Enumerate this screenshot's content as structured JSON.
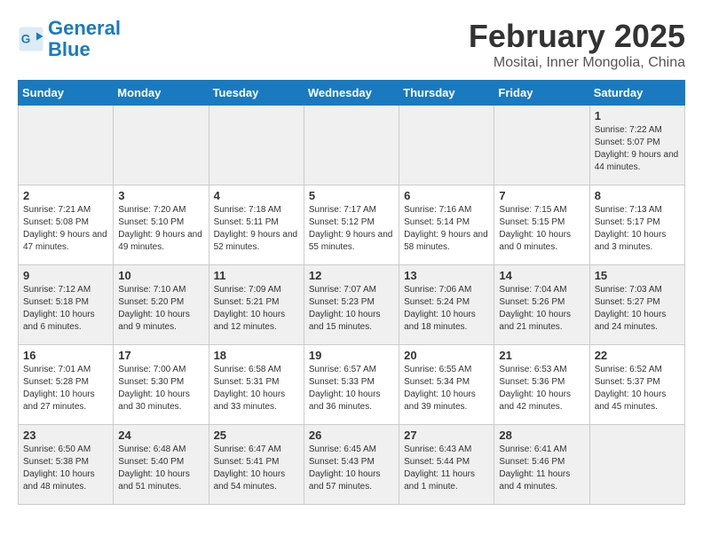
{
  "header": {
    "logo_line1": "General",
    "logo_line2": "Blue",
    "month_year": "February 2025",
    "location": "Mositai, Inner Mongolia, China"
  },
  "weekdays": [
    "Sunday",
    "Monday",
    "Tuesday",
    "Wednesday",
    "Thursday",
    "Friday",
    "Saturday"
  ],
  "weeks": [
    [
      {
        "day": "",
        "info": ""
      },
      {
        "day": "",
        "info": ""
      },
      {
        "day": "",
        "info": ""
      },
      {
        "day": "",
        "info": ""
      },
      {
        "day": "",
        "info": ""
      },
      {
        "day": "",
        "info": ""
      },
      {
        "day": "1",
        "info": "Sunrise: 7:22 AM\nSunset: 5:07 PM\nDaylight: 9 hours and 44 minutes."
      }
    ],
    [
      {
        "day": "2",
        "info": "Sunrise: 7:21 AM\nSunset: 5:08 PM\nDaylight: 9 hours and 47 minutes."
      },
      {
        "day": "3",
        "info": "Sunrise: 7:20 AM\nSunset: 5:10 PM\nDaylight: 9 hours and 49 minutes."
      },
      {
        "day": "4",
        "info": "Sunrise: 7:18 AM\nSunset: 5:11 PM\nDaylight: 9 hours and 52 minutes."
      },
      {
        "day": "5",
        "info": "Sunrise: 7:17 AM\nSunset: 5:12 PM\nDaylight: 9 hours and 55 minutes."
      },
      {
        "day": "6",
        "info": "Sunrise: 7:16 AM\nSunset: 5:14 PM\nDaylight: 9 hours and 58 minutes."
      },
      {
        "day": "7",
        "info": "Sunrise: 7:15 AM\nSunset: 5:15 PM\nDaylight: 10 hours and 0 minutes."
      },
      {
        "day": "8",
        "info": "Sunrise: 7:13 AM\nSunset: 5:17 PM\nDaylight: 10 hours and 3 minutes."
      }
    ],
    [
      {
        "day": "9",
        "info": "Sunrise: 7:12 AM\nSunset: 5:18 PM\nDaylight: 10 hours and 6 minutes."
      },
      {
        "day": "10",
        "info": "Sunrise: 7:10 AM\nSunset: 5:20 PM\nDaylight: 10 hours and 9 minutes."
      },
      {
        "day": "11",
        "info": "Sunrise: 7:09 AM\nSunset: 5:21 PM\nDaylight: 10 hours and 12 minutes."
      },
      {
        "day": "12",
        "info": "Sunrise: 7:07 AM\nSunset: 5:23 PM\nDaylight: 10 hours and 15 minutes."
      },
      {
        "day": "13",
        "info": "Sunrise: 7:06 AM\nSunset: 5:24 PM\nDaylight: 10 hours and 18 minutes."
      },
      {
        "day": "14",
        "info": "Sunrise: 7:04 AM\nSunset: 5:26 PM\nDaylight: 10 hours and 21 minutes."
      },
      {
        "day": "15",
        "info": "Sunrise: 7:03 AM\nSunset: 5:27 PM\nDaylight: 10 hours and 24 minutes."
      }
    ],
    [
      {
        "day": "16",
        "info": "Sunrise: 7:01 AM\nSunset: 5:28 PM\nDaylight: 10 hours and 27 minutes."
      },
      {
        "day": "17",
        "info": "Sunrise: 7:00 AM\nSunset: 5:30 PM\nDaylight: 10 hours and 30 minutes."
      },
      {
        "day": "18",
        "info": "Sunrise: 6:58 AM\nSunset: 5:31 PM\nDaylight: 10 hours and 33 minutes."
      },
      {
        "day": "19",
        "info": "Sunrise: 6:57 AM\nSunset: 5:33 PM\nDaylight: 10 hours and 36 minutes."
      },
      {
        "day": "20",
        "info": "Sunrise: 6:55 AM\nSunset: 5:34 PM\nDaylight: 10 hours and 39 minutes."
      },
      {
        "day": "21",
        "info": "Sunrise: 6:53 AM\nSunset: 5:36 PM\nDaylight: 10 hours and 42 minutes."
      },
      {
        "day": "22",
        "info": "Sunrise: 6:52 AM\nSunset: 5:37 PM\nDaylight: 10 hours and 45 minutes."
      }
    ],
    [
      {
        "day": "23",
        "info": "Sunrise: 6:50 AM\nSunset: 5:38 PM\nDaylight: 10 hours and 48 minutes."
      },
      {
        "day": "24",
        "info": "Sunrise: 6:48 AM\nSunset: 5:40 PM\nDaylight: 10 hours and 51 minutes."
      },
      {
        "day": "25",
        "info": "Sunrise: 6:47 AM\nSunset: 5:41 PM\nDaylight: 10 hours and 54 minutes."
      },
      {
        "day": "26",
        "info": "Sunrise: 6:45 AM\nSunset: 5:43 PM\nDaylight: 10 hours and 57 minutes."
      },
      {
        "day": "27",
        "info": "Sunrise: 6:43 AM\nSunset: 5:44 PM\nDaylight: 11 hours and 1 minute."
      },
      {
        "day": "28",
        "info": "Sunrise: 6:41 AM\nSunset: 5:46 PM\nDaylight: 11 hours and 4 minutes."
      },
      {
        "day": "",
        "info": ""
      }
    ]
  ]
}
